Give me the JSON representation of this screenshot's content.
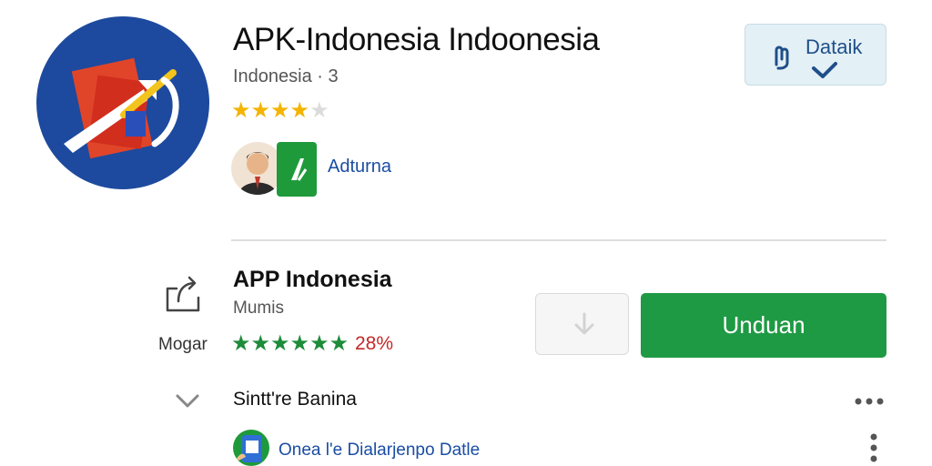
{
  "app": {
    "title": "APK-Indonesia Indoonesia",
    "subtitle": "Indonesia · 3",
    "stars": "★★★★★",
    "rating_filled": 4,
    "rating_max": 5,
    "developer": "Adturna",
    "icon_name": "app-logo-icon"
  },
  "detail_button": {
    "label": "Dataik",
    "icon": "hand-check-icon"
  },
  "listing": {
    "title": "APP Indonesia",
    "subtitle": "Mumis",
    "side_label": "Mogar",
    "stars": "★★★★★★",
    "percent": "28%",
    "install_label": "Unduan",
    "secondary_icon": "download-icon"
  },
  "rows": [
    {
      "label": "Sintt're Banina",
      "icon": "chevron-down-icon",
      "menu_icon": "more-horizontal-icon"
    },
    {
      "label": "Onea l'e Dialarjenpo Datle",
      "icon": "app-thumb-icon",
      "menu_icon": "more-vertical-icon"
    }
  ],
  "colors": {
    "accent_green": "#1f9a44",
    "icon_blue": "#1d4a9e",
    "star_gold": "#f4b400",
    "link_blue": "#1a4da3",
    "percent_red": "#c62828"
  }
}
